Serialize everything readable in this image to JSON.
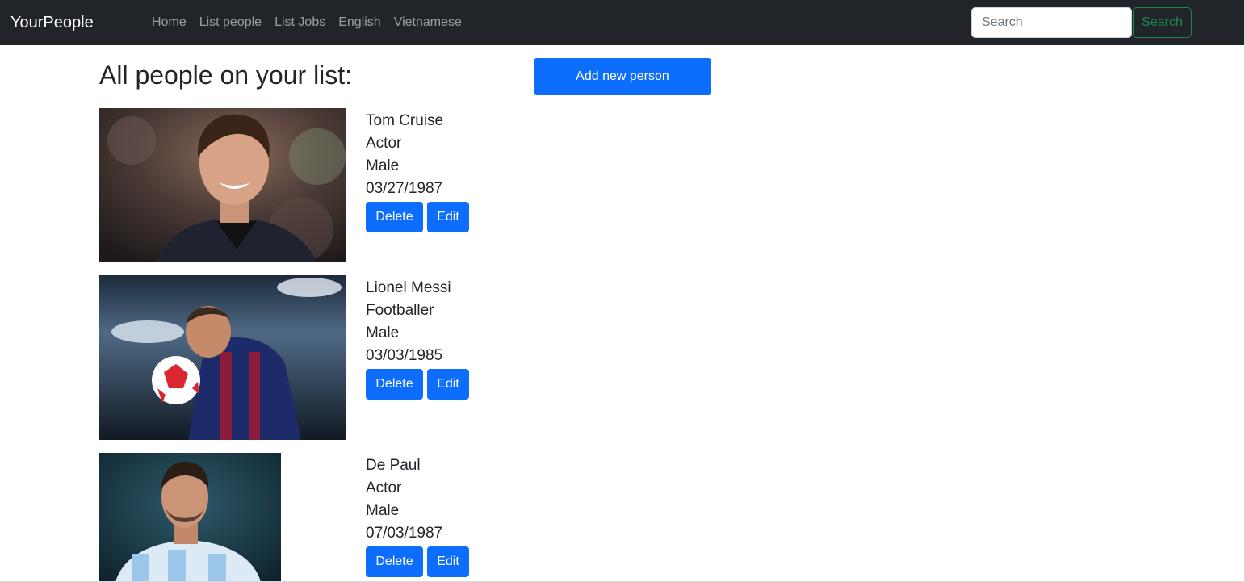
{
  "navbar": {
    "brand": "YourPeople",
    "links": [
      "Home",
      "List people",
      "List Jobs",
      "English",
      "Vietnamese"
    ],
    "search_placeholder": "Search",
    "search_button": "Search"
  },
  "main": {
    "title": "All people on your list:",
    "add_button": "Add new person",
    "delete_label": "Delete",
    "edit_label": "Edit",
    "people": [
      {
        "name": "Tom Cruise",
        "job": "Actor",
        "gender": "Male",
        "dob": "03/27/1987"
      },
      {
        "name": "Lionel Messi",
        "job": "Footballer",
        "gender": "Male",
        "dob": "03/03/1985"
      },
      {
        "name": "De Paul",
        "job": "Actor",
        "gender": "Male",
        "dob": "07/03/1987"
      }
    ]
  }
}
